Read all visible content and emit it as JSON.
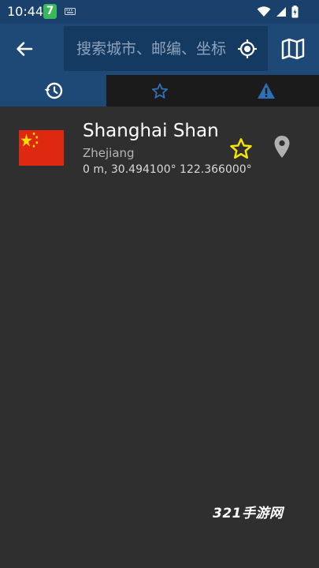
{
  "status_bar": {
    "time": "10:44",
    "app_badge": "7",
    "icons": [
      "keyboard-icon",
      "wifi-icon",
      "signal-icon",
      "battery-icon"
    ]
  },
  "app_bar": {
    "back_icon": "arrow-left-icon",
    "search": {
      "placeholder": "搜索城市、邮编、坐标",
      "value": ""
    },
    "locate_icon": "crosshair-icon",
    "map_icon": "map-icon"
  },
  "tabs": [
    {
      "icon": "history-icon",
      "active": true
    },
    {
      "icon": "star-outline-icon",
      "active": false
    },
    {
      "icon": "warning-icon",
      "active": false
    }
  ],
  "results": [
    {
      "flag": "china-flag",
      "name": "Shanghai Shan",
      "region": "Zhejiang",
      "details": "0 m, 30.494100° 122.366000°",
      "favorite_icon": "star-outline-icon",
      "pin_icon": "location-pin-icon"
    }
  ],
  "watermark": "321手游网",
  "colors": {
    "status_bar": "#19416b",
    "app_bar": "#1e4876",
    "search_box": "#153a61",
    "tab_bar": "#1b1b1b",
    "background": "#2f2f2f",
    "accent_blue": "#2f6fb6",
    "favorite_yellow": "#f5e400",
    "flag_red": "#de2910",
    "flag_yellow": "#ffde00"
  }
}
